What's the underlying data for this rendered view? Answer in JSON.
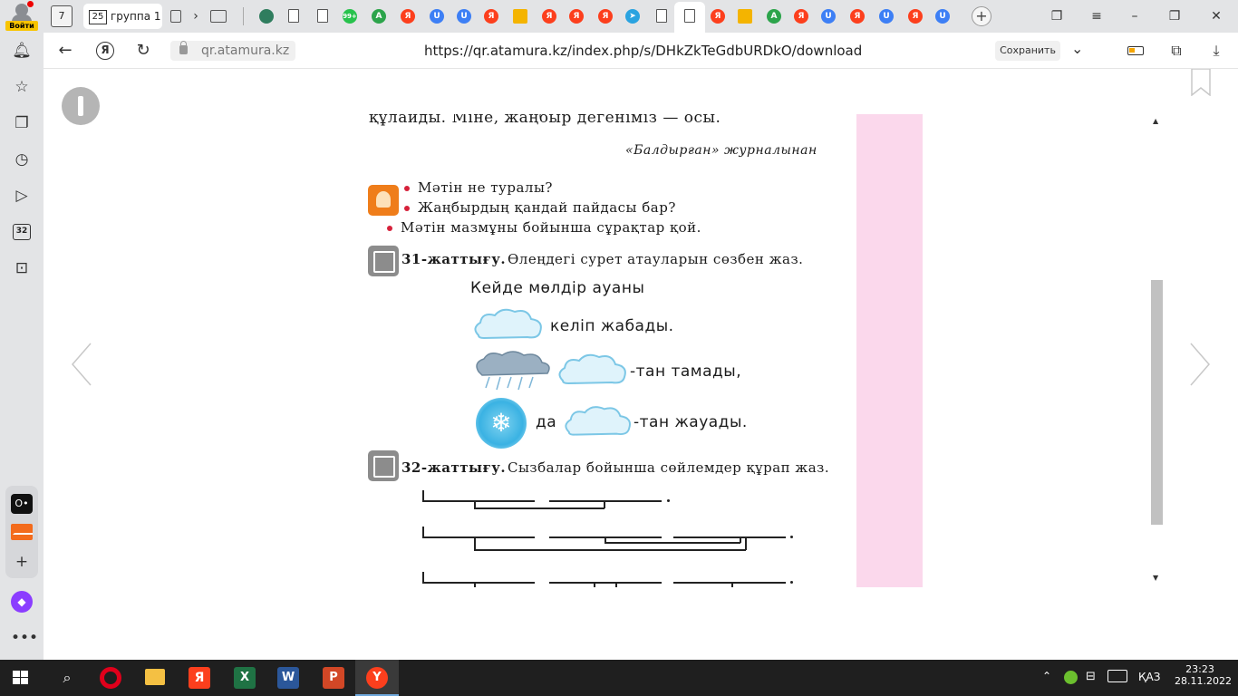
{
  "tabbar": {
    "profile_label": "Войти",
    "tab_count": "7",
    "group_count": "25",
    "group_label": "группа 1",
    "new_tab_symbol": "+",
    "tab_icons": [
      "globe-icon",
      "doc-icon",
      "doc-icon",
      "whatsapp-icon",
      "green-a-icon",
      "yandex-icon",
      "u-icon",
      "u-icon",
      "yandex-icon",
      "image-icon",
      "yandex-icon",
      "yandex-icon",
      "yandex-icon",
      "telegram-icon",
      "doc-icon",
      "doc-icon",
      "yandex-icon",
      "image-icon",
      "green-a-icon",
      "yandex-icon",
      "u-icon",
      "yandex-icon",
      "u-icon",
      "yandex-icon",
      "u-icon"
    ],
    "wa_badge": "99+"
  },
  "navbar": {
    "domain": "qr.atamura.kz",
    "url": "https://qr.atamura.kz/index.php/s/DHkZkTeGdbURDkO/download",
    "save_label": "Сохранить"
  },
  "sidebar": {
    "items": [
      "bell-icon",
      "star-icon",
      "collections-icon",
      "history-icon",
      "video-icon",
      "calendar-icon",
      "screenshot-icon"
    ],
    "calendar_day": "32"
  },
  "page": {
    "top_line": "құлайды. Міне, жаңбыр дегеніміз — осы.",
    "source": "«Балдырған» журналынан",
    "questions": [
      "Мәтін не туралы?",
      "Жаңбырдың қандай пайдасы бар?",
      "Мәтін мазмұны бойынша сұрақтар қой."
    ],
    "ex31_label": "31-жаттығу.",
    "ex31_task": "Өлеңдегі сурет атауларын сөзбен жаз.",
    "poem_line1": "Кейде мөлдір ауаны",
    "poem_line2": "келіп жабады.",
    "poem_line3": "-тан тамады,",
    "poem_line4_da": "да",
    "poem_line4": "-тан жауады.",
    "ex32_label": "32-жаттығу.",
    "ex32_task": "Сызбалар бойынша сөйлемдер құрап жаз."
  },
  "taskbar": {
    "lang": "ҚАЗ",
    "time": "23:23",
    "date": "28.11.2022"
  },
  "colors": {
    "pink_margin": "#fbd8ec",
    "taskbar": "#1f1f1f",
    "bullet": "#d6213a"
  }
}
